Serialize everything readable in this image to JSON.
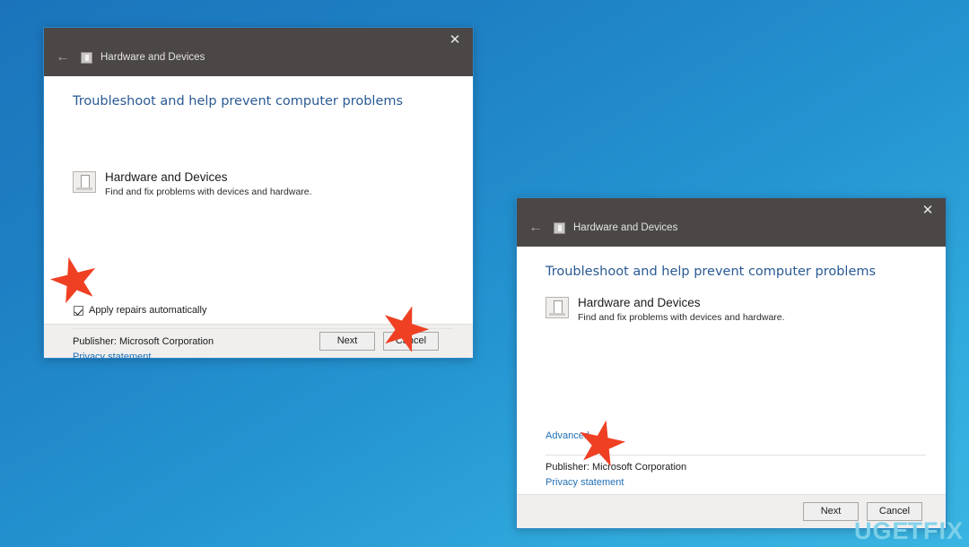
{
  "background": {
    "gradient_from": "#1b74bb",
    "gradient_to": "#3ab5e2"
  },
  "dialogs": [
    {
      "id": "primary",
      "titlebar": {
        "back_icon": "←",
        "app_icon": "hardware-icon",
        "title": "Hardware and Devices",
        "close_icon": "✕"
      },
      "headline": "Troubleshoot and help prevent computer problems",
      "pack": {
        "icon": "hardware-icon",
        "title": "Hardware and Devices",
        "subtitle": "Find and fix problems with devices and hardware."
      },
      "checkbox": {
        "label": "Apply repairs automatically",
        "checked": true
      },
      "publisher": "Publisher:  Microsoft Corporation",
      "privacy_link": "Privacy statement",
      "buttons": {
        "next": "Next",
        "cancel": "Cancel"
      }
    },
    {
      "id": "secondary",
      "titlebar": {
        "back_icon": "←",
        "app_icon": "hardware-icon",
        "title": "Hardware and Devices",
        "close_icon": "✕"
      },
      "headline": "Troubleshoot and help prevent computer problems",
      "pack": {
        "icon": "hardware-icon",
        "title": "Hardware and Devices",
        "subtitle": "Find and fix problems with devices and hardware."
      },
      "advanced_link": "Advanced",
      "publisher": "Publisher:  Microsoft Corporation",
      "privacy_link": "Privacy statement",
      "buttons": {
        "next": "Next",
        "cancel": "Cancel"
      }
    }
  ],
  "markers": {
    "color": "#ef4023",
    "count": 3
  },
  "watermark": {
    "part1": "UG",
    "part2": "E",
    "part3": "TFIX",
    "color": "#7fd2ea"
  }
}
